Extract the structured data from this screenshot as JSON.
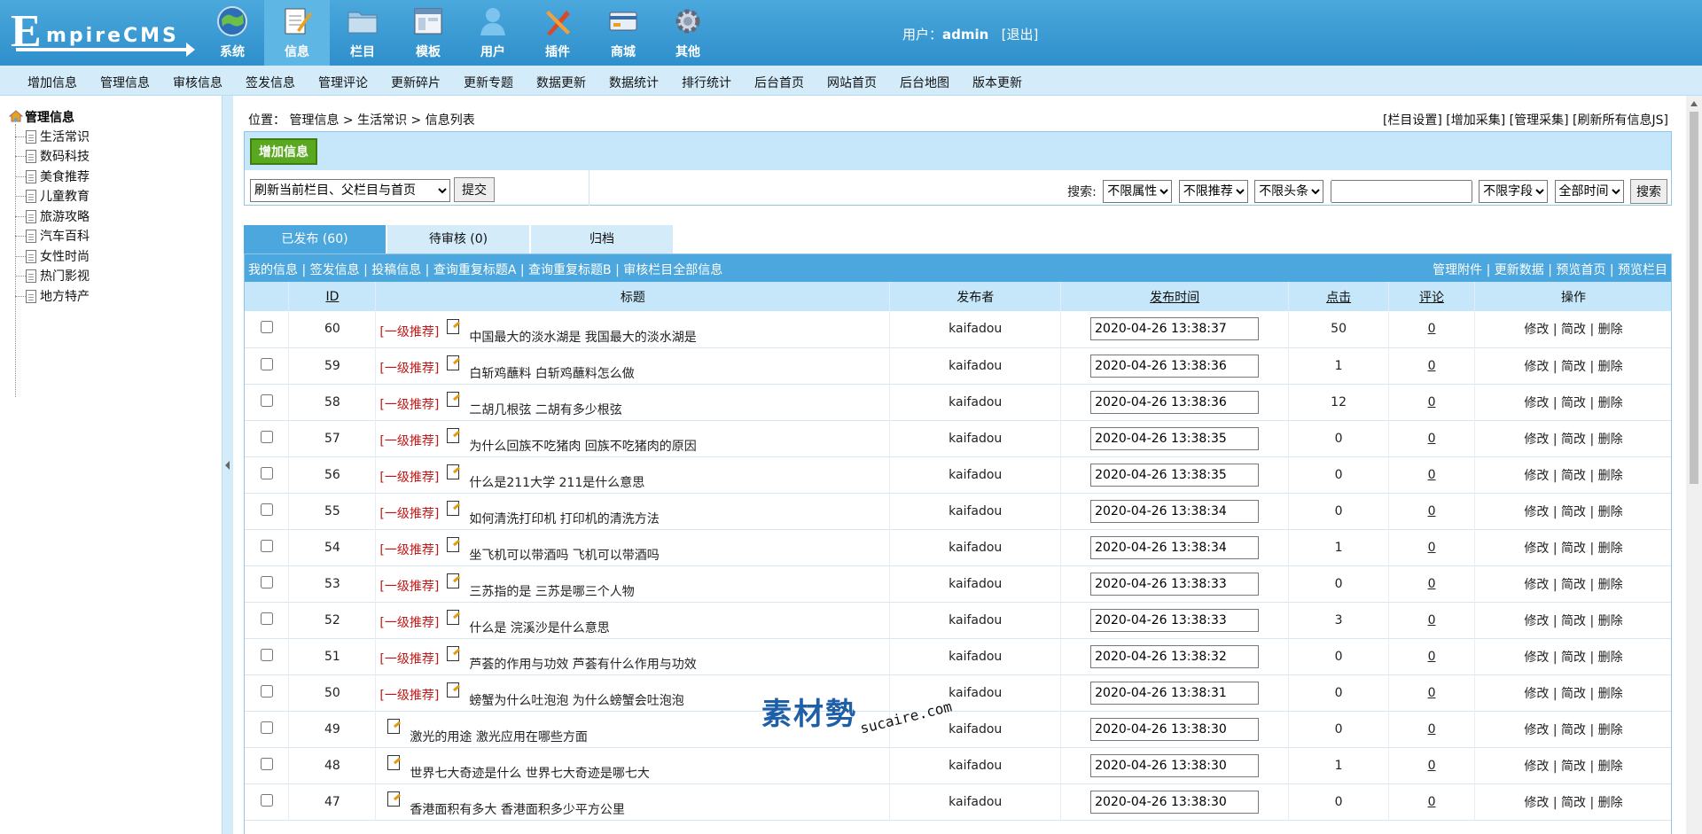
{
  "header": {
    "logo_text_first": "E",
    "logo_text_rest": "mpireCMS",
    "nav": [
      {
        "label": "系统",
        "icon": "globe-icon"
      },
      {
        "label": "信息",
        "icon": "notepad-icon",
        "active": true
      },
      {
        "label": "栏目",
        "icon": "folder-icon"
      },
      {
        "label": "模板",
        "icon": "window-icon"
      },
      {
        "label": "用户",
        "icon": "user-icon"
      },
      {
        "label": "插件",
        "icon": "tools-icon"
      },
      {
        "label": "商城",
        "icon": "card-icon"
      },
      {
        "label": "其他",
        "icon": "gear-icon"
      }
    ],
    "user_prefix": "用户：",
    "username": "admin",
    "logout": "[退出]"
  },
  "submenu": [
    "增加信息",
    "管理信息",
    "审核信息",
    "签发信息",
    "管理评论",
    "更新碎片",
    "更新专题",
    "数据更新",
    "数据统计",
    "排行统计",
    "后台首页",
    "网站首页",
    "后台地图",
    "版本更新"
  ],
  "sidebar": {
    "root": "管理信息",
    "items": [
      "生活常识",
      "数码科技",
      "美食推荐",
      "儿童教育",
      "旅游攻略",
      "汽车百科",
      "女性时尚",
      "热门影视",
      "地方特产"
    ]
  },
  "breadcrumb": "位置：  管理信息 > 生活常识 > 信息列表",
  "toplinks": "[栏目设置] [增加采集] [管理采集] [刷新所有信息JS]",
  "actions": {
    "add_button": "增加信息",
    "refresh_select": "刷新当前栏目、父栏目与首页",
    "submit": "提交",
    "search_label": "搜索:",
    "filter_attr": "不限属性",
    "filter_recommend": "不限推荐",
    "filter_headline": "不限头条",
    "search_value": "",
    "filter_field": "不限字段",
    "filter_time": "全部时间",
    "search_button": "搜索"
  },
  "tabs": [
    "已发布 (60)",
    "待审核 (0)",
    "归档"
  ],
  "list_links": {
    "left": "我的信息 | 签发信息 | 投稿信息 | 查询重复标题A | 查询重复标题B | 审核栏目全部信息",
    "right": "管理附件 | 更新数据 | 预览首页 | 预览栏目"
  },
  "table": {
    "headers": [
      "ID",
      "标题",
      "发布者",
      "发布时间",
      "点击",
      "评论",
      "操作"
    ],
    "ops": "修改 | 简改 | 删除",
    "rec_label": "[一级推荐]",
    "rows": [
      {
        "id": "60",
        "rec": true,
        "title": "中国最大的淡水湖是 我国最大的淡水湖是",
        "author": "kaifadou",
        "time": "2020-04-26 13:38:37",
        "clicks": "50",
        "comments": "0"
      },
      {
        "id": "59",
        "rec": true,
        "title": "白斩鸡蘸料 白斩鸡蘸料怎么做",
        "author": "kaifadou",
        "time": "2020-04-26 13:38:36",
        "clicks": "1",
        "comments": "0"
      },
      {
        "id": "58",
        "rec": true,
        "title": "二胡几根弦 二胡有多少根弦",
        "author": "kaifadou",
        "time": "2020-04-26 13:38:36",
        "clicks": "12",
        "comments": "0"
      },
      {
        "id": "57",
        "rec": true,
        "title": "为什么回族不吃猪肉 回族不吃猪肉的原因",
        "author": "kaifadou",
        "time": "2020-04-26 13:38:35",
        "clicks": "0",
        "comments": "0"
      },
      {
        "id": "56",
        "rec": true,
        "title": "什么是211大学 211是什么意思",
        "author": "kaifadou",
        "time": "2020-04-26 13:38:35",
        "clicks": "0",
        "comments": "0"
      },
      {
        "id": "55",
        "rec": true,
        "title": "如何清洗打印机 打印机的清洗方法",
        "author": "kaifadou",
        "time": "2020-04-26 13:38:34",
        "clicks": "0",
        "comments": "0"
      },
      {
        "id": "54",
        "rec": true,
        "title": "坐飞机可以带酒吗 飞机可以带酒吗",
        "author": "kaifadou",
        "time": "2020-04-26 13:38:34",
        "clicks": "1",
        "comments": "0"
      },
      {
        "id": "53",
        "rec": true,
        "title": "三苏指的是 三苏是哪三个人物",
        "author": "kaifadou",
        "time": "2020-04-26 13:38:33",
        "clicks": "0",
        "comments": "0"
      },
      {
        "id": "52",
        "rec": true,
        "title": "什么是 浣溪沙是什么意思",
        "author": "kaifadou",
        "time": "2020-04-26 13:38:33",
        "clicks": "3",
        "comments": "0"
      },
      {
        "id": "51",
        "rec": true,
        "title": "芦荟的作用与功效 芦荟有什么作用与功效",
        "author": "kaifadou",
        "time": "2020-04-26 13:38:32",
        "clicks": "0",
        "comments": "0"
      },
      {
        "id": "50",
        "rec": true,
        "title": "螃蟹为什么吐泡泡 为什么螃蟹会吐泡泡",
        "author": "kaifadou",
        "time": "2020-04-26 13:38:31",
        "clicks": "0",
        "comments": "0"
      },
      {
        "id": "49",
        "rec": false,
        "title": "激光的用途 激光应用在哪些方面",
        "author": "kaifadou",
        "time": "2020-04-26 13:38:30",
        "clicks": "0",
        "comments": "0"
      },
      {
        "id": "48",
        "rec": false,
        "title": "世界七大奇迹是什么 世界七大奇迹是哪七大",
        "author": "kaifadou",
        "time": "2020-04-26 13:38:30",
        "clicks": "1",
        "comments": "0"
      },
      {
        "id": "47",
        "rec": false,
        "title": "香港面积有多大 香港面积多少平方公里",
        "author": "kaifadou",
        "time": "2020-04-26 13:38:30",
        "clicks": "0",
        "comments": "0"
      }
    ]
  },
  "watermark": {
    "text": "素材勢",
    "domain": "sucaire.com"
  },
  "colors": {
    "header_blue": "#2f8fcb",
    "light_blue": "#c5e7f9",
    "tab_blue": "#4ba7dd",
    "rec_red": "#c01818",
    "add_green": "#5aa820"
  }
}
